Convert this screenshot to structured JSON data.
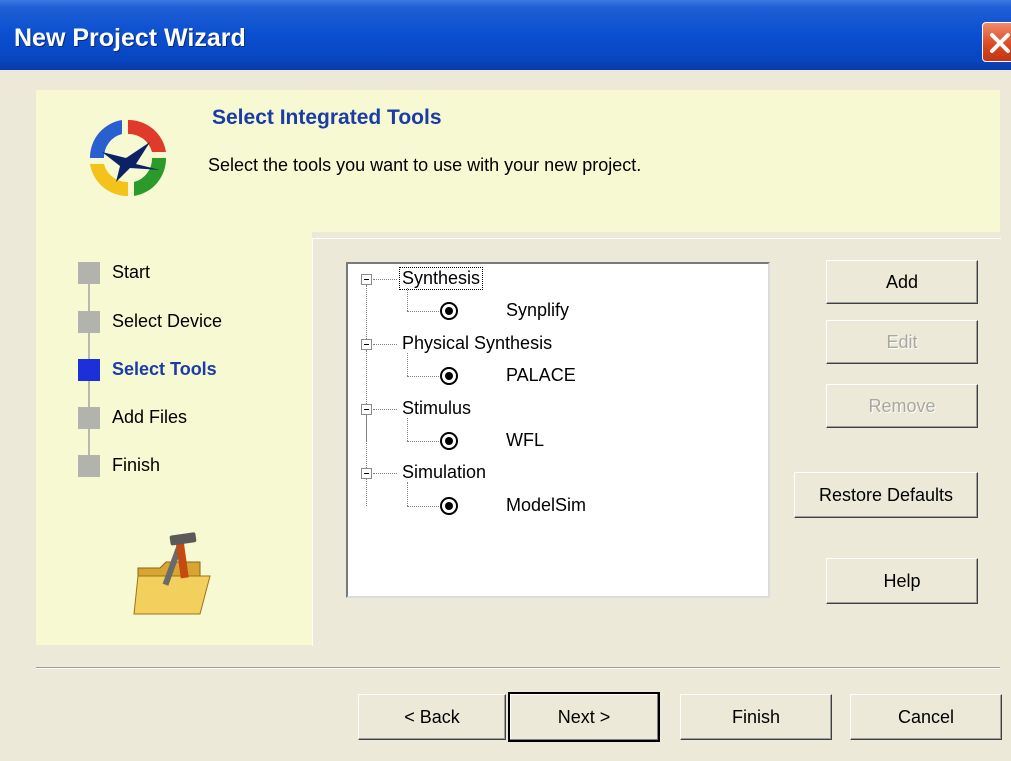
{
  "window": {
    "title": "New Project Wizard"
  },
  "header": {
    "title": "Select Integrated Tools",
    "description": "Select the tools you want to use with your new project."
  },
  "steps": [
    {
      "label": "Start",
      "active": false
    },
    {
      "label": "Select Device",
      "active": false
    },
    {
      "label": "Select Tools",
      "active": true
    },
    {
      "label": "Add Files",
      "active": false
    },
    {
      "label": "Finish",
      "active": false
    }
  ],
  "tools_tree": [
    {
      "category": "Synthesis",
      "tool": "Synplify",
      "focused": true
    },
    {
      "category": "Physical Synthesis",
      "tool": "PALACE",
      "focused": false
    },
    {
      "category": "Stimulus",
      "tool": "WFL",
      "focused": false
    },
    {
      "category": "Simulation",
      "tool": "ModelSim",
      "focused": false
    }
  ],
  "side_buttons": {
    "add": "Add",
    "edit": "Edit",
    "remove": "Remove",
    "restore_defaults": "Restore Defaults",
    "help": "Help"
  },
  "footer_buttons": {
    "back": "< Back",
    "next": "Next >",
    "finish": "Finish",
    "cancel": "Cancel"
  },
  "colors": {
    "titlebar": "#0a4fd0",
    "panel_bg": "#f7f9d3",
    "dialog_bg": "#ece9d8",
    "accent_text": "#1b3ca8",
    "active_step": "#1d2fd8"
  },
  "icons": {
    "wizard_logo": "wizard-logo-icon",
    "close": "close-icon",
    "folder_tools": "folder-tools-icon"
  }
}
